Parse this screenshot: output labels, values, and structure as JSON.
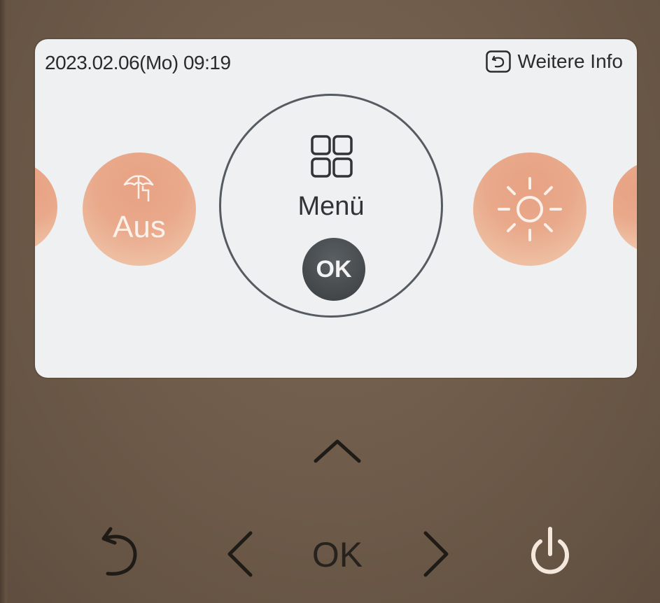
{
  "screen": {
    "datetime": "2023.02.06(Mo)  09:19",
    "info_label": "Weitere Info",
    "modes": [
      {
        "id": "partial-left",
        "icon": "mode-partial"
      },
      {
        "id": "off",
        "label": "Aus",
        "icon": "umbrella-icon"
      },
      {
        "id": "heating",
        "icon": "sun-icon"
      },
      {
        "id": "partial-right",
        "icon": "mode-partial"
      }
    ],
    "menu": {
      "label": "Menü",
      "icon": "grid-icon",
      "ok_label": "OK"
    }
  },
  "buttons": {
    "up": "chevron-up-icon",
    "back": "back-arrow-icon",
    "left": "chevron-left-icon",
    "ok_label": "OK",
    "right": "chevron-right-icon",
    "power": "power-icon"
  },
  "colors": {
    "housing": "#6f5c4b",
    "screen": "#eef0f1",
    "mode_circle": "#e9a98b",
    "ok_circle": "#3f4447",
    "power_icon": "#f4e7dc"
  }
}
